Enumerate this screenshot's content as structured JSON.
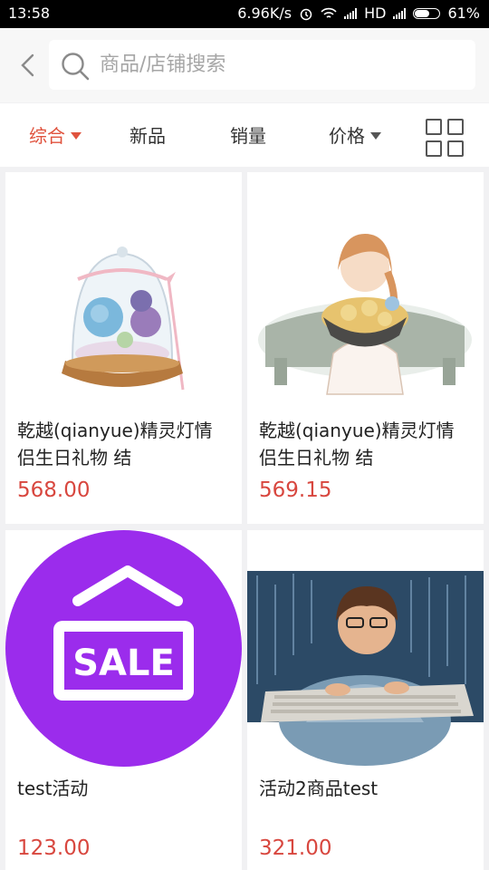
{
  "status": {
    "time": "13:58",
    "net_speed": "6.96K/s",
    "network": "HD",
    "battery": "61%",
    "battery_level": 0.61
  },
  "search": {
    "placeholder": "商品/店铺搜索"
  },
  "filters": [
    {
      "label": "综合",
      "active": true,
      "has_caret": true
    },
    {
      "label": "新品"
    },
    {
      "label": "销量"
    },
    {
      "label": "价格",
      "has_caret": true
    }
  ],
  "products": [
    {
      "name": "乾越(qianyue)精灵灯情侣生日礼物 结",
      "price": "568.00",
      "image": "rose-glass-dome"
    },
    {
      "name": "乾越(qianyue)精灵灯情侣生日礼物 结",
      "price": "569.15",
      "image": "girl-with-flowers"
    },
    {
      "name": "test活动",
      "price": "123.00",
      "image": "sale-sign",
      "image_text": "SALE"
    },
    {
      "name": "活动2商品test",
      "price": "321.00",
      "image": "boy-at-keyboard"
    }
  ],
  "colors": {
    "accent": "#e0533e",
    "price": "#d8473f",
    "sale_purple": "#9b2cec"
  }
}
